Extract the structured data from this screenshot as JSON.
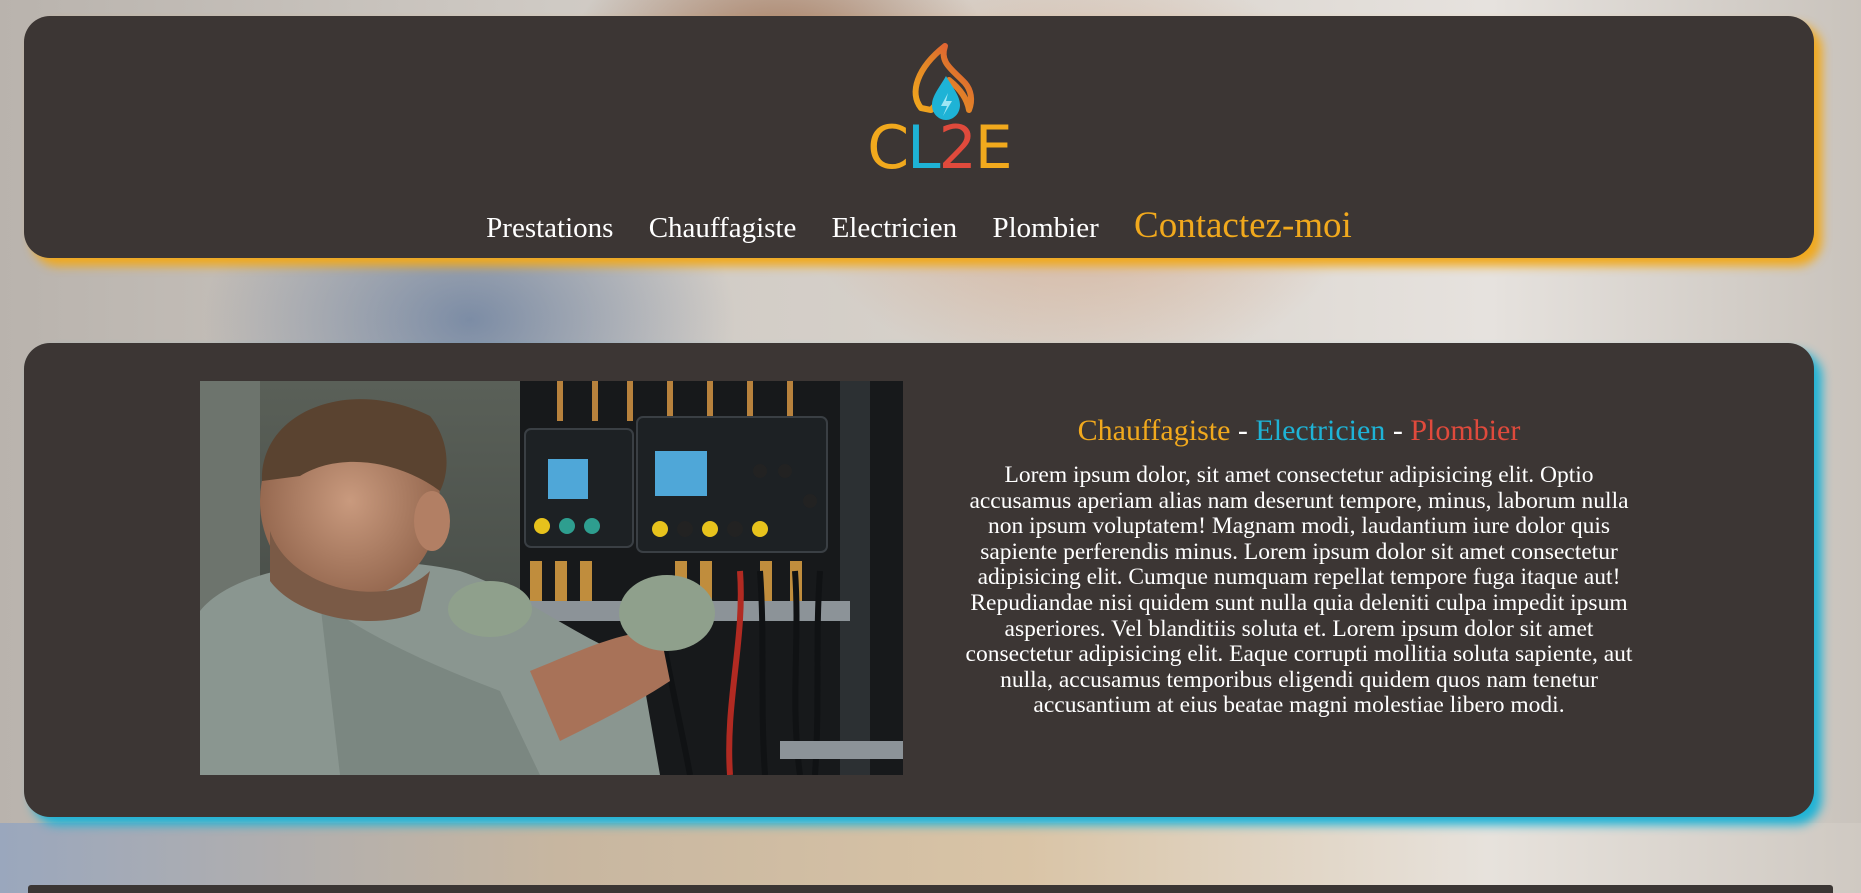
{
  "brand": {
    "name": "CL2E",
    "colors": {
      "orange": "#f1a91d",
      "blue": "#1eb3d6",
      "red": "#e04a3c",
      "card": "#3c3634"
    }
  },
  "nav": {
    "items": [
      {
        "label": "Prestations"
      },
      {
        "label": "Chauffagiste"
      },
      {
        "label": "Electricien"
      },
      {
        "label": "Plombier"
      }
    ],
    "contact_label": "Contactez-moi"
  },
  "hero": {
    "trades": {
      "heating": "Chauffagiste",
      "separator": " - ",
      "electric": "Electricien",
      "plumbing": "Plombier"
    },
    "body": "Lorem ipsum dolor, sit amet consectetur adipisicing elit. Optio accusamus aperiam alias nam deserunt tempore, minus, laborum nulla non ipsum voluptatem! Magnam modi, laudantium iure dolor quis sapiente perferendis minus. Lorem ipsum dolor sit amet consectetur adipisicing elit. Cumque numquam repellat tempore fuga itaque aut! Repudiandae nisi quidem sunt nulla quia deleniti culpa impedit ipsum asperiores. Vel blanditiis soluta et. Lorem ipsum dolor sit amet consectetur adipisicing elit. Eaque corrupti mollitia soluta sapiente, aut nulla, accusamus temporibus eligendi quidem quos nam tenetur accusantium at eius beatae magni molestiae libero modi.",
    "image": "technician-working-on-electrical-panel"
  }
}
